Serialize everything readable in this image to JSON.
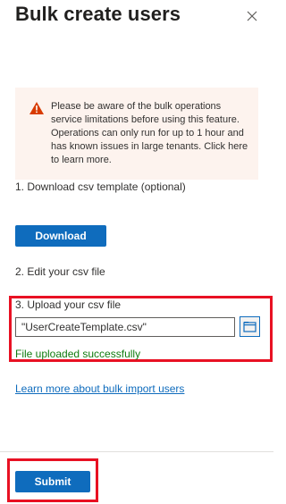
{
  "panel": {
    "title": "Bulk create users"
  },
  "warning": {
    "text": "Please be aware of the bulk operations service limitations before using this feature. Operations can only run for up to 1 hour and has known issues in large tenants. Click here to learn more."
  },
  "steps": {
    "step1_label": "1. Download csv template (optional)",
    "download_label": "Download",
    "step2_label": "2. Edit your csv file",
    "step3_label": "3. Upload your csv file",
    "file_value": "\"UserCreateTemplate.csv\"",
    "upload_status": "File uploaded successfully"
  },
  "links": {
    "learn_more": "Learn more about bulk import users"
  },
  "footer": {
    "submit_label": "Submit"
  },
  "colors": {
    "primary": "#0f6cbd",
    "success": "#107c10",
    "warning_bg": "#fdf3ee",
    "warning_icon": "#d83b01",
    "highlight": "#e81123"
  },
  "icons": {
    "close": "close-icon",
    "warning": "warning-icon",
    "browse": "folder-icon"
  }
}
